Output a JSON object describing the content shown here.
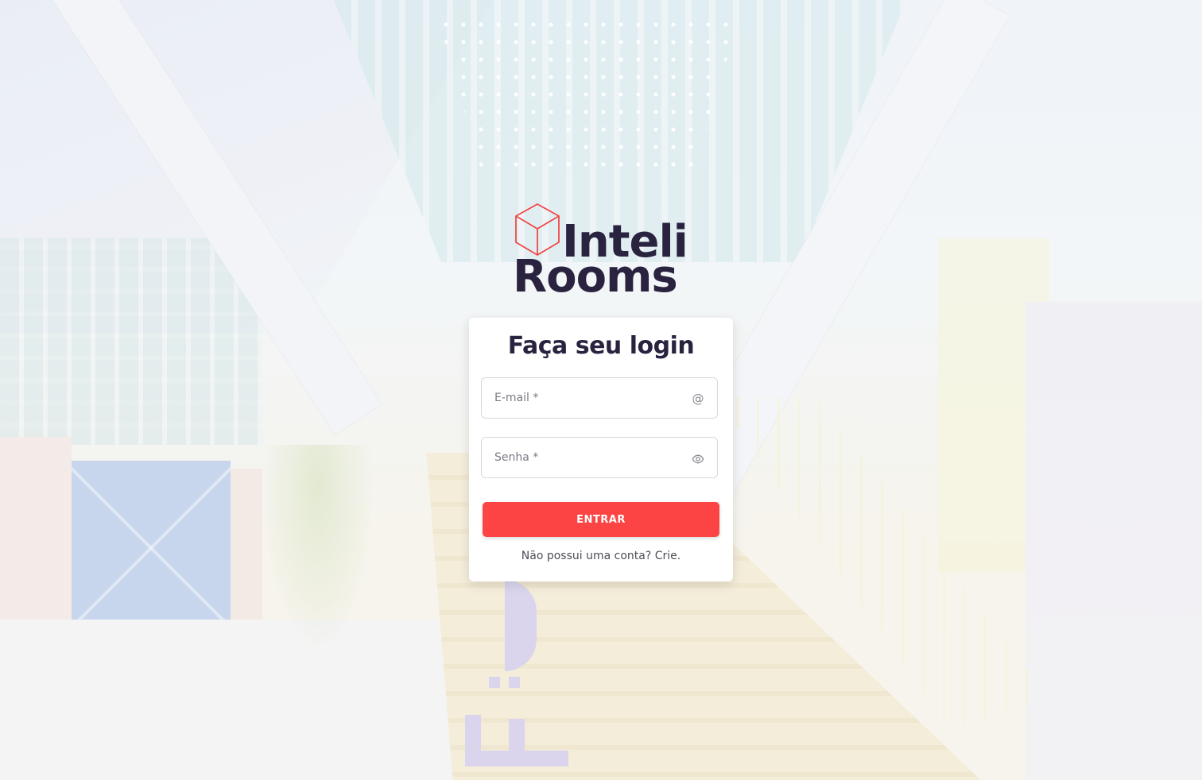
{
  "logo": {
    "line1": "Inteli",
    "line2": "Rooms",
    "icon": "cube-icon",
    "accent_color": "#f04747",
    "text_color": "#2a2340"
  },
  "login": {
    "title": "Faça seu login",
    "email": {
      "placeholder": "E-mail *",
      "value": "",
      "icon": "at-sign-icon"
    },
    "password": {
      "placeholder": "Senha *",
      "value": "",
      "icon": "eye-icon"
    },
    "submit_label": "ENTRAR",
    "submit_color": "#fd4444",
    "signup_prompt": "Não possui uma conta?",
    "signup_link": "Crie."
  }
}
